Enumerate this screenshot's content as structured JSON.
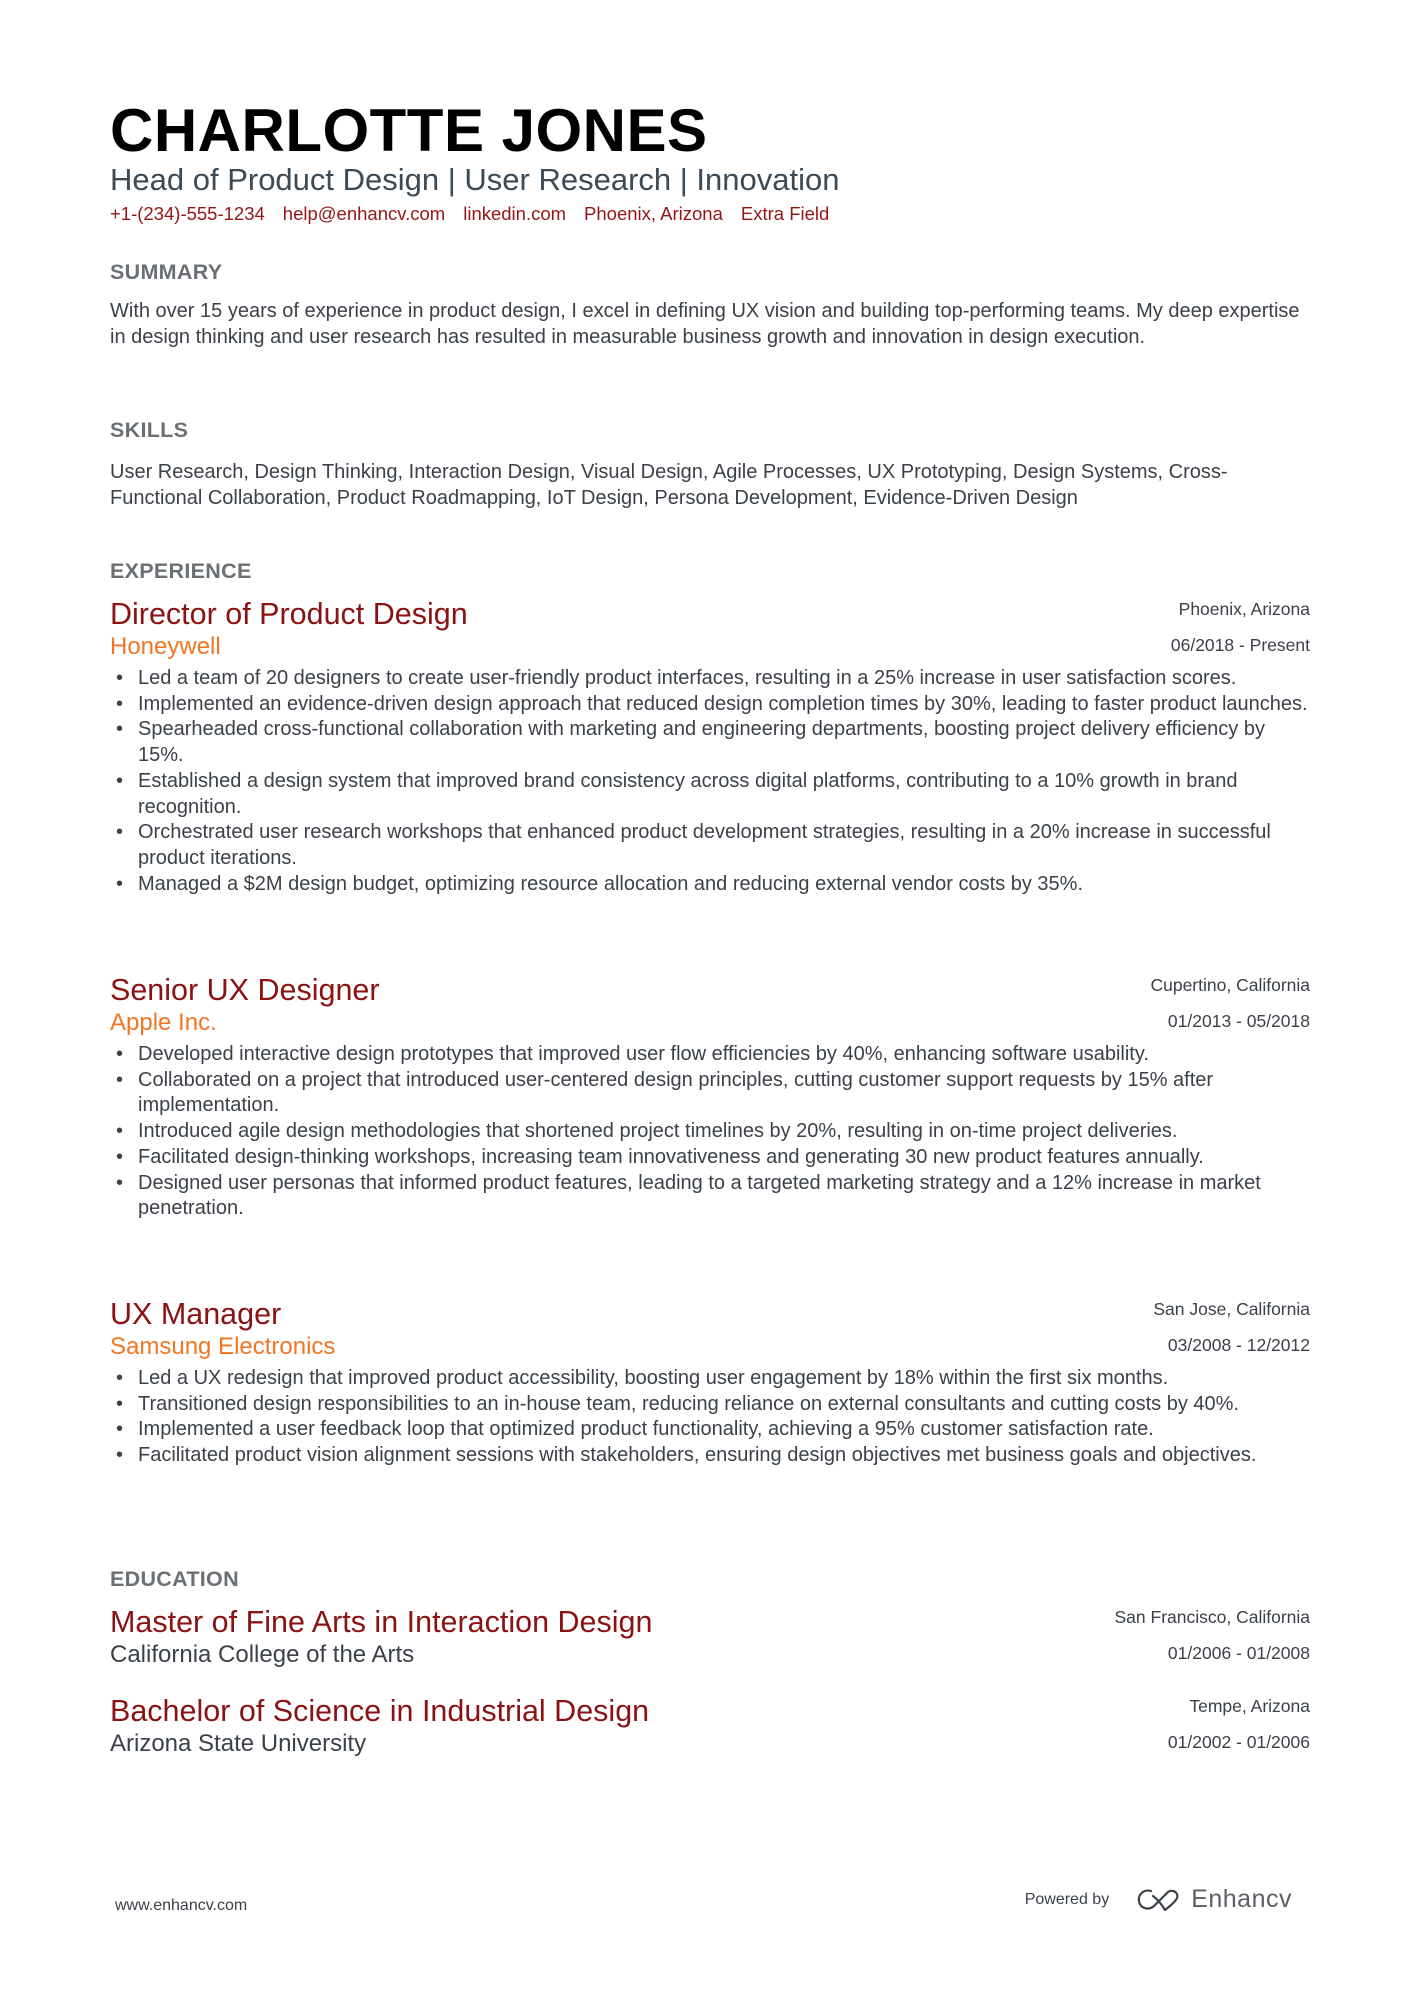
{
  "header": {
    "name": "CHARLOTTE JONES",
    "headline": "Head of Product Design | User Research | Innovation",
    "contacts": [
      "+1-(234)-555-1234",
      "help@enhancv.com",
      "linkedin.com",
      "Phoenix, Arizona",
      "Extra Field"
    ]
  },
  "summary": {
    "title": "SUMMARY",
    "text": "With over 15 years of experience in product design, I excel in defining UX vision and building top-performing teams. My deep expertise in design thinking and user research has resulted in measurable business growth and innovation in design execution."
  },
  "skills": {
    "title": "SKILLS",
    "text": "User Research, Design Thinking, Interaction Design, Visual Design, Agile Processes, UX Prototyping, Design Systems, Cross-Functional Collaboration, Product Roadmapping, IoT Design, Persona Development, Evidence-Driven Design"
  },
  "experience": {
    "title": "EXPERIENCE",
    "jobs": [
      {
        "title": "Director of Product Design",
        "company": "Honeywell",
        "location": "Phoenix, Arizona",
        "dates": "06/2018 - Present",
        "bullets": [
          "Led a team of 20 designers to create user-friendly product interfaces, resulting in a 25% increase in user satisfaction scores.",
          "Implemented an evidence-driven design approach that reduced design completion times by 30%, leading to faster product launches.",
          "Spearheaded cross-functional collaboration with marketing and engineering departments, boosting project delivery efficiency by 15%.",
          "Established a design system that improved brand consistency across digital platforms, contributing to a 10% growth in brand recognition.",
          "Orchestrated user research workshops that enhanced product development strategies, resulting in a 20% increase in successful product iterations.",
          "Managed a $2M design budget, optimizing resource allocation and reducing external vendor costs by 35%."
        ]
      },
      {
        "title": "Senior UX Designer",
        "company": "Apple Inc.",
        "location": "Cupertino, California",
        "dates": "01/2013 - 05/2018",
        "bullets": [
          "Developed interactive design prototypes that improved user flow efficiencies by 40%, enhancing software usability.",
          "Collaborated on a project that introduced user-centered design principles, cutting customer support requests by 15% after implementation.",
          "Introduced agile design methodologies that shortened project timelines by 20%, resulting in on-time project deliveries.",
          "Facilitated design-thinking workshops, increasing team innovativeness and generating 30 new product features annually.",
          "Designed user personas that informed product features, leading to a targeted marketing strategy and a 12% increase in market penetration."
        ]
      },
      {
        "title": "UX Manager",
        "company": "Samsung Electronics",
        "location": "San Jose, California",
        "dates": "03/2008 - 12/2012",
        "bullets": [
          "Led a UX redesign that improved product accessibility, boosting user engagement by 18% within the first six months.",
          "Transitioned design responsibilities to an in-house team, reducing reliance on external consultants and cutting costs by 40%.",
          "Implemented a user feedback loop that optimized product functionality, achieving a 95% customer satisfaction rate.",
          "Facilitated product vision alignment sessions with stakeholders, ensuring design objectives met business goals and objectives."
        ]
      }
    ]
  },
  "education": {
    "title": "EDUCATION",
    "items": [
      {
        "degree": "Master of Fine Arts in Interaction Design",
        "school": "California College of the Arts",
        "location": "San Francisco, California",
        "dates": "01/2006 - 01/2008"
      },
      {
        "degree": "Bachelor of Science in Industrial Design",
        "school": "Arizona State University",
        "location": "Tempe, Arizona",
        "dates": "01/2002 - 01/2006"
      }
    ]
  },
  "footer": {
    "website": "www.enhancv.com",
    "powered_by": "Powered by",
    "brand": "Enhancv",
    "logo_icon": "enhancv-logo-icon"
  },
  "colors": {
    "name": "#000000",
    "contact": "#951515",
    "job_title": "#8b1212",
    "company": "#f27622",
    "section_title": "#6b7075",
    "body_text": "#3b4148"
  }
}
